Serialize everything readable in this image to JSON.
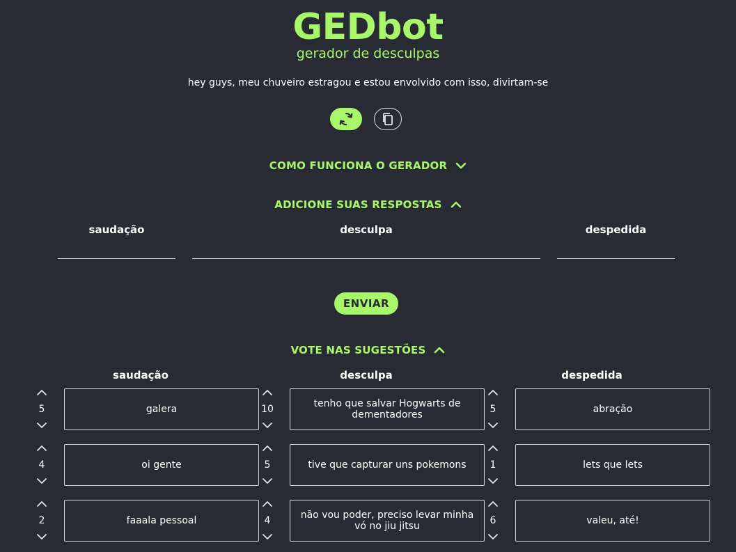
{
  "header": {
    "title": "GEDbot",
    "subtitle": "gerador de desculpas",
    "message": "hey guys, meu chuveiro estragou e estou envolvido com isso, divirtam-se"
  },
  "actions": {
    "refresh_icon": "refresh-icon",
    "copy_icon": "copy-icon"
  },
  "sections": {
    "how_it_works": "COMO FUNCIONA O GERADOR",
    "add_answers": "ADICIONE SUAS RESPOSTAS",
    "vote": "VOTE NAS SUGESTÕES"
  },
  "form": {
    "labels": {
      "greeting": "saudação",
      "excuse": "desculpa",
      "farewell": "despedida"
    },
    "values": {
      "greeting": "",
      "excuse": "",
      "farewell": ""
    },
    "send_label": "ENVIAR"
  },
  "vote": {
    "labels": {
      "greeting": "saudação",
      "excuse": "desculpa",
      "farewell": "despedida"
    },
    "greeting": [
      {
        "count": "5",
        "text": "galera"
      },
      {
        "count": "4",
        "text": "oi gente"
      },
      {
        "count": "2",
        "text": "faaala pessoal"
      }
    ],
    "excuse": [
      {
        "count": "10",
        "text": "tenho que salvar Hogwarts de dementadores"
      },
      {
        "count": "5",
        "text": "tive que capturar uns pokemons"
      },
      {
        "count": "4",
        "text": "não vou poder, preciso levar minha vó no jiu jitsu"
      }
    ],
    "farewell": [
      {
        "count": "5",
        "text": "abração"
      },
      {
        "count": "1",
        "text": "lets que lets"
      },
      {
        "count": "6",
        "text": "valeu, até!"
      }
    ]
  },
  "colors": {
    "background": "#282b33",
    "accent": "#a8f76a",
    "text": "#ffffff"
  }
}
